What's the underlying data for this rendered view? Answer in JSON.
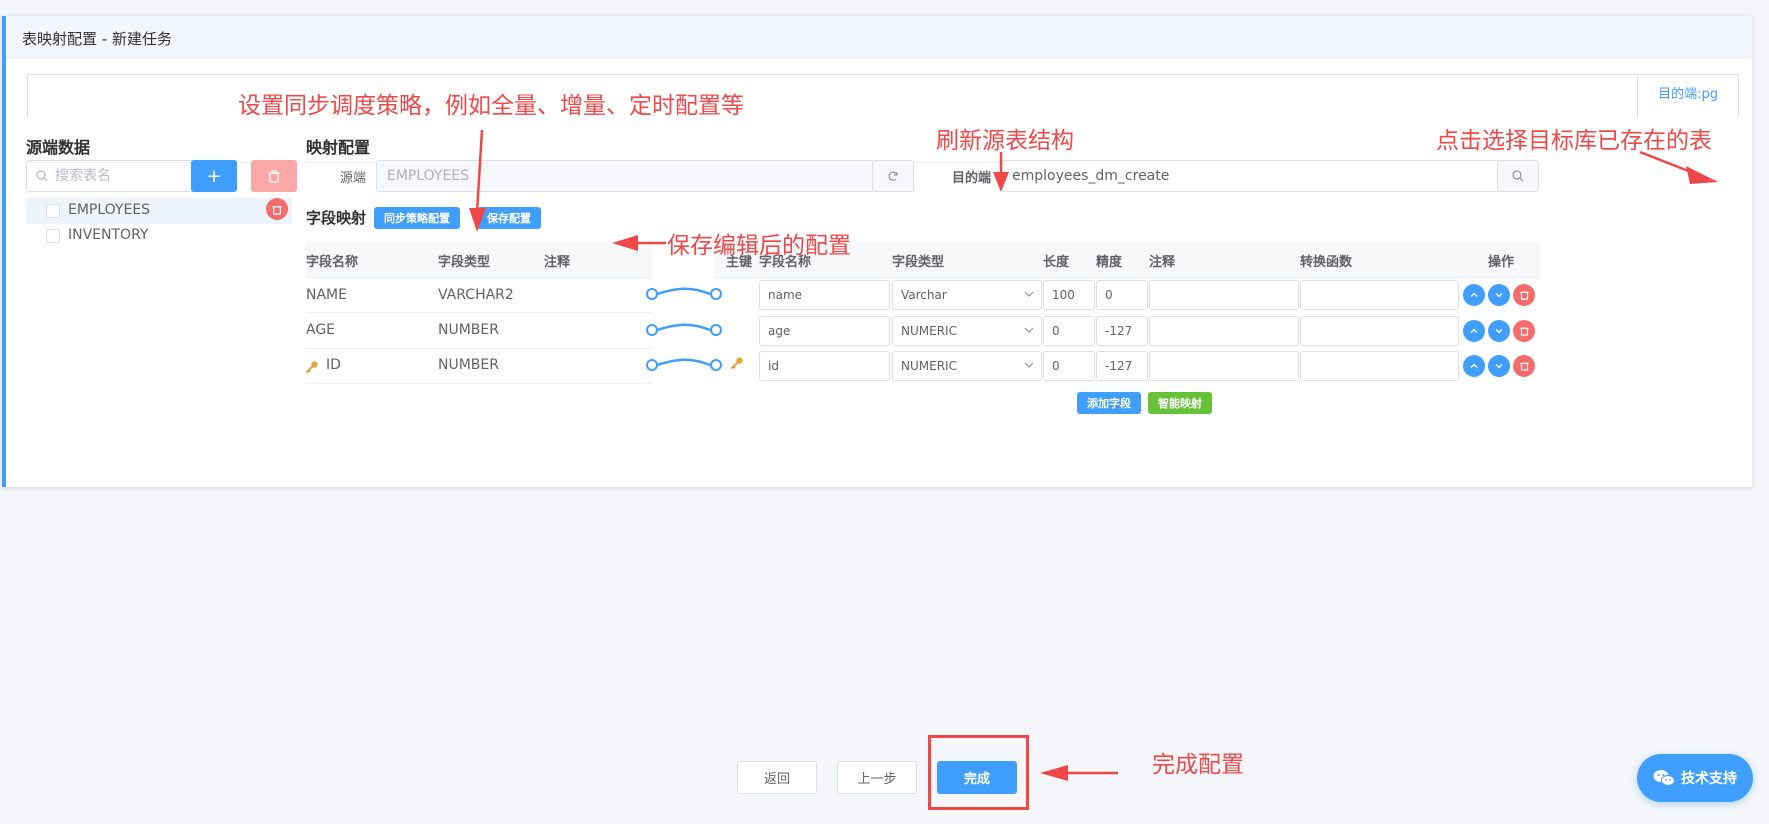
{
  "header": {
    "title": "表映射配置 - 新建任务"
  },
  "tabs": {
    "target_label": "目的端:pg"
  },
  "source_panel": {
    "title": "源端数据",
    "search_placeholder": "搜索表名",
    "add_label": "+",
    "tables": [
      {
        "name": "EMPLOYEES",
        "active": true
      },
      {
        "name": "INVENTORY",
        "active": false
      }
    ]
  },
  "mapping": {
    "title": "映射配置",
    "source_label": "源端",
    "source_value": "EMPLOYEES",
    "target_label": "目的端",
    "target_value": "employees_dm_create",
    "field_mapping_title": "字段映射",
    "sync_strategy_btn": "同步策略配置",
    "save_btn": "保存配置",
    "src_columns": [
      "字段名称",
      "字段类型",
      "注释"
    ],
    "tgt_columns": [
      "主键",
      "字段名称",
      "字段类型",
      "长度",
      "精度",
      "注释",
      "转换函数",
      "操作"
    ],
    "rows": [
      {
        "src_name": "NAME",
        "src_type": "VARCHAR2",
        "src_comment": "",
        "pk": false,
        "tgt_name": "name",
        "tgt_type": "Varchar",
        "length": "100",
        "precision": "0",
        "comment": "",
        "func": ""
      },
      {
        "src_name": "AGE",
        "src_type": "NUMBER",
        "src_comment": "",
        "pk": false,
        "tgt_name": "age",
        "tgt_type": "NUMERIC",
        "length": "0",
        "precision": "-127",
        "comment": "",
        "func": ""
      },
      {
        "src_name": "ID",
        "src_type": "NUMBER",
        "src_comment": "",
        "pk": true,
        "tgt_name": "id",
        "tgt_type": "NUMERIC",
        "length": "0",
        "precision": "-127",
        "comment": "",
        "func": ""
      }
    ],
    "add_field_btn": "添加字段",
    "smart_map_btn": "智能映射"
  },
  "footer": {
    "back": "返回",
    "prev": "上一步",
    "finish": "完成"
  },
  "annotations": {
    "sync": "设置同步调度策略，例如全量、增量、定时配置等",
    "refresh": "刷新源表结构",
    "select_target": "点击选择目标库已存在的表",
    "save": "保存编辑后的配置",
    "finish": "完成配置"
  },
  "support": {
    "label": "技术支持",
    "icon": "wechat-icon"
  },
  "colors": {
    "primary": "#409eff",
    "danger": "#f56c6c",
    "success": "#67c23a",
    "annotation": "#f04848"
  }
}
